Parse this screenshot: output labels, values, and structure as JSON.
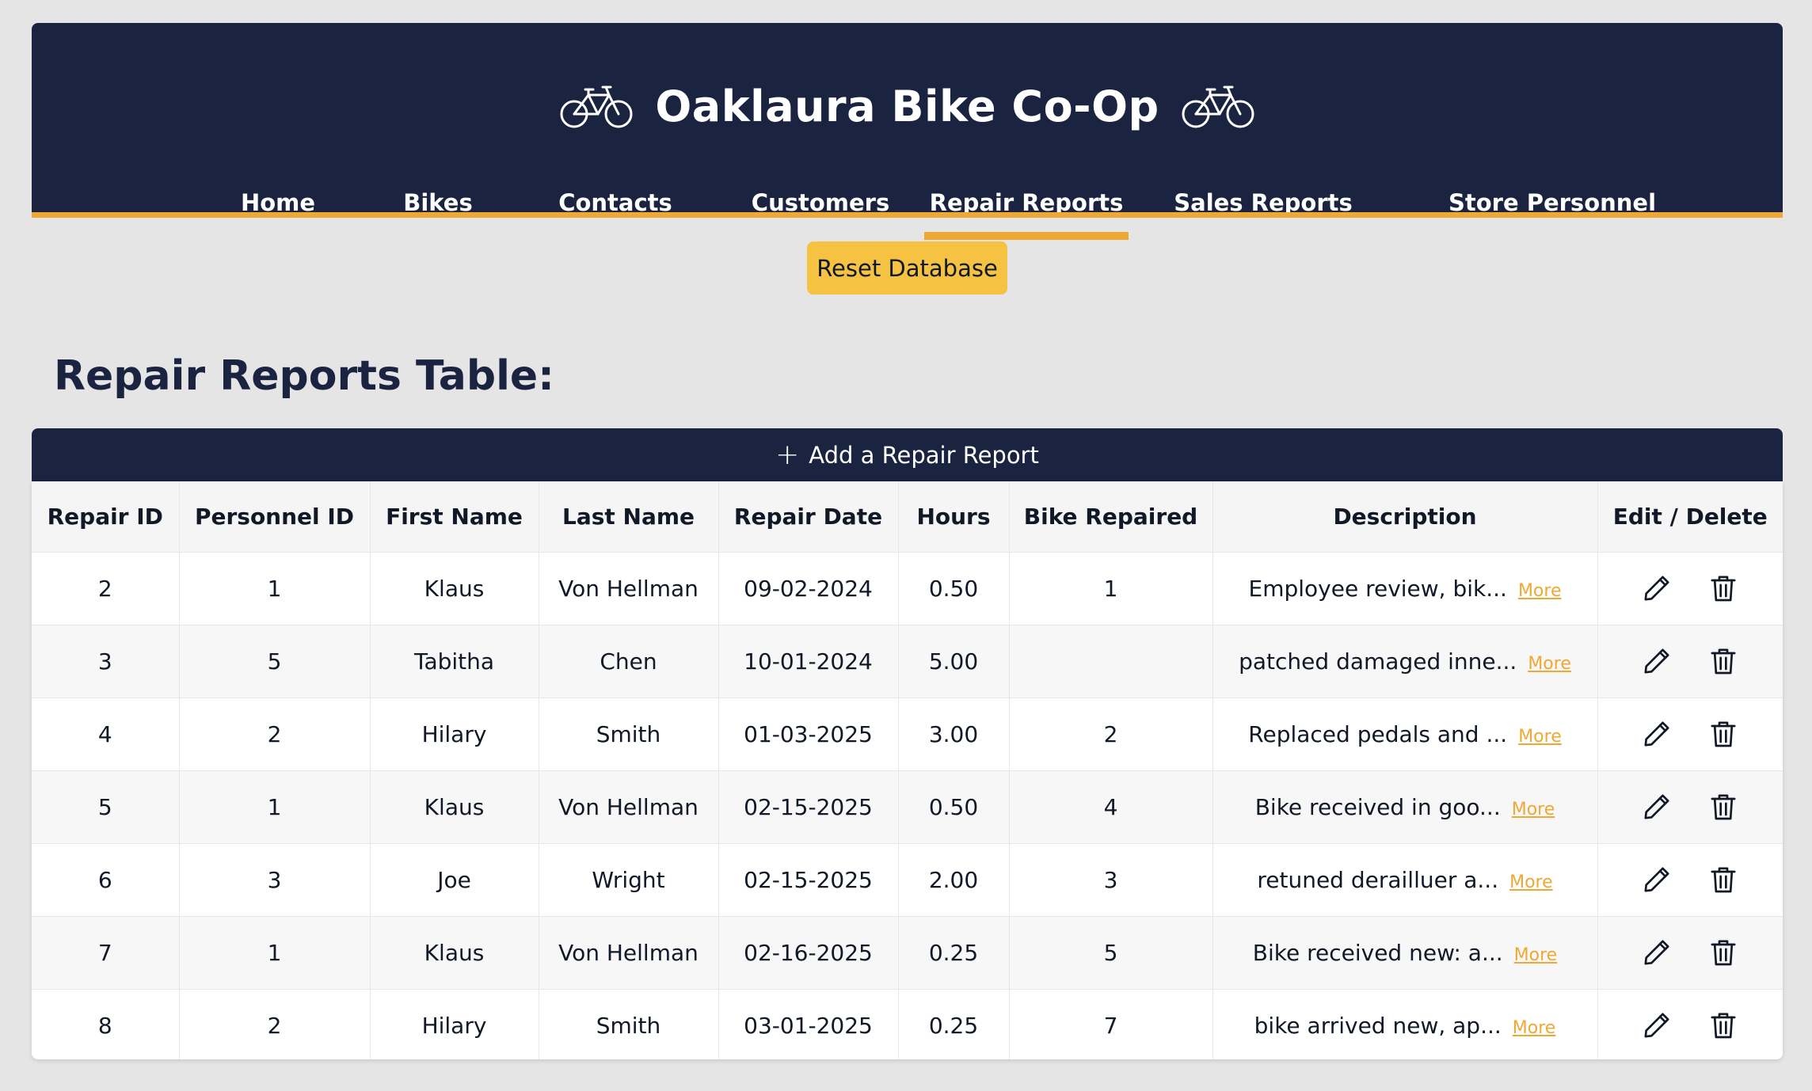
{
  "app": {
    "title": "Oaklaura Bike Co-Op",
    "icons": [
      "bicycle-icon",
      "bicycle-icon"
    ]
  },
  "nav": {
    "items": [
      {
        "label": "Home"
      },
      {
        "label": "Bikes"
      },
      {
        "label": "Contacts"
      },
      {
        "label": "Customers"
      },
      {
        "label": "Repair Reports",
        "active": true
      },
      {
        "label": "Sales Reports"
      },
      {
        "label": "Store Personnel"
      }
    ]
  },
  "actions": {
    "reset_label": "Reset Database",
    "add_label": "Add a Repair Report"
  },
  "section": {
    "title": "Repair Reports Table:"
  },
  "table": {
    "columns": [
      "Repair ID",
      "Personnel ID",
      "First Name",
      "Last Name",
      "Repair Date",
      "Hours",
      "Bike Repaired",
      "Description",
      "Edit / Delete"
    ],
    "more_label": "More",
    "rows": [
      {
        "repair_id": "2",
        "personnel_id": "1",
        "first_name": "Klaus",
        "last_name": "Von Hellman",
        "repair_date": "09-02-2024",
        "hours": "0.50",
        "bike": "1",
        "description": "Employee review, bik..."
      },
      {
        "repair_id": "3",
        "personnel_id": "5",
        "first_name": "Tabitha",
        "last_name": "Chen",
        "repair_date": "10-01-2024",
        "hours": "5.00",
        "bike": "",
        "description": "patched damaged inne..."
      },
      {
        "repair_id": "4",
        "personnel_id": "2",
        "first_name": "Hilary",
        "last_name": "Smith",
        "repair_date": "01-03-2025",
        "hours": "3.00",
        "bike": "2",
        "description": "Replaced pedals and ..."
      },
      {
        "repair_id": "5",
        "personnel_id": "1",
        "first_name": "Klaus",
        "last_name": "Von Hellman",
        "repair_date": "02-15-2025",
        "hours": "0.50",
        "bike": "4",
        "description": "Bike received in goo..."
      },
      {
        "repair_id": "6",
        "personnel_id": "3",
        "first_name": "Joe",
        "last_name": "Wright",
        "repair_date": "02-15-2025",
        "hours": "2.00",
        "bike": "3",
        "description": "retuned derailluer a..."
      },
      {
        "repair_id": "7",
        "personnel_id": "1",
        "first_name": "Klaus",
        "last_name": "Von Hellman",
        "repair_date": "02-16-2025",
        "hours": "0.25",
        "bike": "5",
        "description": "Bike received new: a..."
      },
      {
        "repair_id": "8",
        "personnel_id": "2",
        "first_name": "Hilary",
        "last_name": "Smith",
        "repair_date": "03-01-2025",
        "hours": "0.25",
        "bike": "7",
        "description": "bike arrived new, ap..."
      }
    ]
  },
  "colors": {
    "navy": "#1a2340",
    "accent": "#f0a834",
    "button": "#f5c242",
    "background": "#e5e5e5"
  }
}
